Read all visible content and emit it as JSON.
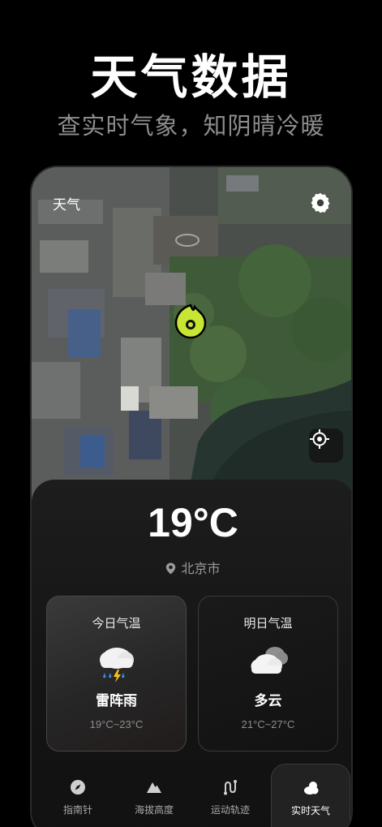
{
  "hero": {
    "title": "天气数据",
    "subtitle": "查实时气象，知阴晴冷暖"
  },
  "map": {
    "header_label": "天气",
    "settings_icon": "gear-icon",
    "locate_icon": "crosshair-icon",
    "pin_icon": "location-pin-icon",
    "pin_color": "#c6e633"
  },
  "weather": {
    "temperature": "19°C",
    "city": "北京市",
    "today": {
      "title": "今日气温",
      "condition": "雷阵雨",
      "range": "19°C~23°C",
      "icon": "thunderstorm-cloud-icon"
    },
    "tomorrow": {
      "title": "明日气温",
      "condition": "多云",
      "range": "21°C~27°C",
      "icon": "cloudy-icon"
    }
  },
  "tabs": [
    {
      "label": "指南针",
      "icon": "compass-icon",
      "active": false
    },
    {
      "label": "海拔高度",
      "icon": "mountain-icon",
      "active": false
    },
    {
      "label": "运动轨迹",
      "icon": "route-icon",
      "active": false
    },
    {
      "label": "实时天气",
      "icon": "weather-cloud-icon",
      "active": true
    }
  ],
  "colors": {
    "background": "#000000",
    "accent": "#c6e633",
    "subtitle": "#8d8d8d"
  }
}
